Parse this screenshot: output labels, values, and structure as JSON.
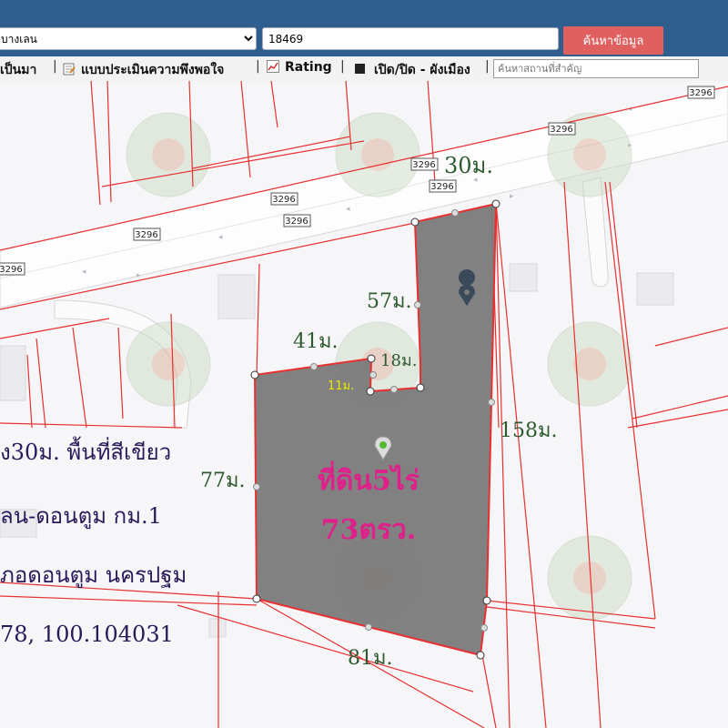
{
  "toolbar": {
    "district_value": "บางเลน",
    "parcel_value": "18469",
    "search_label": "ค้นหาข้อมูล"
  },
  "menu": {
    "history_label": "เป็นมา",
    "survey_label": "แบบประเมินความพึงพอใจ",
    "rating_label": "Rating",
    "toggle_label": "เปิด/ปิด - ผังเมือง",
    "landmark_placeholder": "ค้นหาสถานที่สำคัญ"
  },
  "map": {
    "road_markers": [
      "3296",
      "3296",
      "3296",
      "3296",
      "3296",
      "3296",
      "3296"
    ],
    "dimensions": {
      "front": "30ม.",
      "top_inner": "57ม.",
      "left_top": "41ม.",
      "notch_width": "18ม.",
      "notch_depth": "11ม.",
      "right_side": "158ม.",
      "left_side": "77ม.",
      "bottom": "81ม."
    },
    "land_title_line1": "ที่ดิน5ไร่",
    "land_title_line2": "73ตรว.",
    "overlay_text": {
      "line1": "ง30ม. พื้นที่สีเขียว",
      "line2": "ลน-ดอนตูม กม.1",
      "line3": "ภอดอนตูม นครปฐม",
      "line4": "78, 100.104031"
    },
    "colors": {
      "parcel_fill": "#7a7a7a",
      "boundary": "#e83030",
      "title": "#e0208a",
      "dimension_text": "#2f5a2f",
      "overlay_text": "#2a1a5a",
      "notch_label": "#e8e800"
    }
  }
}
